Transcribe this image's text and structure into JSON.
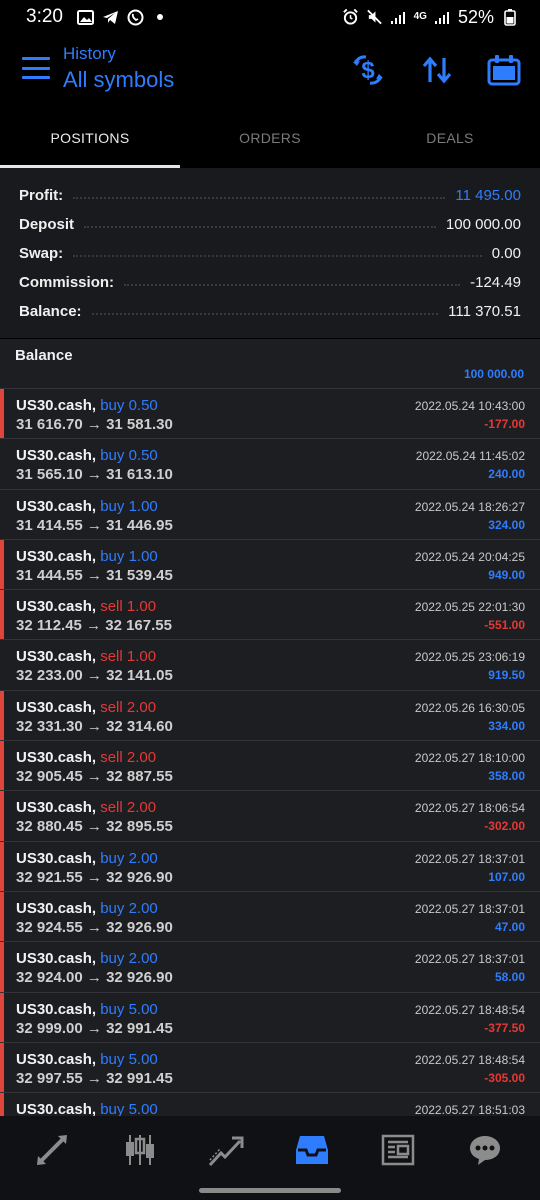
{
  "status_bar": {
    "time": "3:20",
    "battery": "52%",
    "network": "4G"
  },
  "header": {
    "subtitle": "History",
    "title": "All symbols"
  },
  "tabs": [
    {
      "label": "POSITIONS",
      "active": true
    },
    {
      "label": "ORDERS",
      "active": false
    },
    {
      "label": "DEALS",
      "active": false
    }
  ],
  "summary": [
    {
      "label": "Profit:",
      "value": "11 495.00",
      "accent": "blue"
    },
    {
      "label": "Deposit",
      "value": "100 000.00",
      "accent": ""
    },
    {
      "label": "Swap:",
      "value": "0.00",
      "accent": ""
    },
    {
      "label": "Commission:",
      "value": "-124.49",
      "accent": ""
    },
    {
      "label": "Balance:",
      "value": "111 370.51",
      "accent": ""
    }
  ],
  "balance_entry": {
    "label": "Balance",
    "value": "100 000.00"
  },
  "trades": [
    {
      "symbol": "US30.cash,",
      "side": "buy",
      "side_label": "buy 0.50",
      "prices": "31 616.70 → 31 581.30",
      "time": "2022.05.24 10:43:00",
      "pl": "-177.00",
      "pl_sign": "neg",
      "marked": true
    },
    {
      "symbol": "US30.cash,",
      "side": "buy",
      "side_label": "buy 0.50",
      "prices": "31 565.10 → 31 613.10",
      "time": "2022.05.24 11:45:02",
      "pl": "240.00",
      "pl_sign": "pos",
      "marked": false
    },
    {
      "symbol": "US30.cash,",
      "side": "buy",
      "side_label": "buy 1.00",
      "prices": "31 414.55 → 31 446.95",
      "time": "2022.05.24 18:26:27",
      "pl": "324.00",
      "pl_sign": "pos",
      "marked": false
    },
    {
      "symbol": "US30.cash,",
      "side": "buy",
      "side_label": "buy 1.00",
      "prices": "31 444.55 → 31 539.45",
      "time": "2022.05.24 20:04:25",
      "pl": "949.00",
      "pl_sign": "pos",
      "marked": true
    },
    {
      "symbol": "US30.cash,",
      "side": "sell",
      "side_label": "sell 1.00",
      "prices": "32 112.45 → 32 167.55",
      "time": "2022.05.25 22:01:30",
      "pl": "-551.00",
      "pl_sign": "neg",
      "marked": true
    },
    {
      "symbol": "US30.cash,",
      "side": "sell",
      "side_label": "sell 1.00",
      "prices": "32 233.00 → 32 141.05",
      "time": "2022.05.25 23:06:19",
      "pl": "919.50",
      "pl_sign": "pos",
      "marked": false
    },
    {
      "symbol": "US30.cash,",
      "side": "sell",
      "side_label": "sell 2.00",
      "prices": "32 331.30 → 32 314.60",
      "time": "2022.05.26 16:30:05",
      "pl": "334.00",
      "pl_sign": "pos",
      "marked": true
    },
    {
      "symbol": "US30.cash,",
      "side": "sell",
      "side_label": "sell 2.00",
      "prices": "32 905.45 → 32 887.55",
      "time": "2022.05.27 18:10:00",
      "pl": "358.00",
      "pl_sign": "pos",
      "marked": true
    },
    {
      "symbol": "US30.cash,",
      "side": "sell",
      "side_label": "sell 2.00",
      "prices": "32 880.45 → 32 895.55",
      "time": "2022.05.27 18:06:54",
      "pl": "-302.00",
      "pl_sign": "neg",
      "marked": true
    },
    {
      "symbol": "US30.cash,",
      "side": "buy",
      "side_label": "buy 2.00",
      "prices": "32 921.55 → 32 926.90",
      "time": "2022.05.27 18:37:01",
      "pl": "107.00",
      "pl_sign": "pos",
      "marked": true
    },
    {
      "symbol": "US30.cash,",
      "side": "buy",
      "side_label": "buy 2.00",
      "prices": "32 924.55 → 32 926.90",
      "time": "2022.05.27 18:37:01",
      "pl": "47.00",
      "pl_sign": "pos",
      "marked": true
    },
    {
      "symbol": "US30.cash,",
      "side": "buy",
      "side_label": "buy 2.00",
      "prices": "32 924.00 → 32 926.90",
      "time": "2022.05.27 18:37:01",
      "pl": "58.00",
      "pl_sign": "pos",
      "marked": true
    },
    {
      "symbol": "US30.cash,",
      "side": "buy",
      "side_label": "buy 5.00",
      "prices": "32 999.00 → 32 991.45",
      "time": "2022.05.27 18:48:54",
      "pl": "-377.50",
      "pl_sign": "neg",
      "marked": true
    },
    {
      "symbol": "US30.cash,",
      "side": "buy",
      "side_label": "buy 5.00",
      "prices": "32 997.55 → 32 991.45",
      "time": "2022.05.27 18:48:54",
      "pl": "-305.00",
      "pl_sign": "neg",
      "marked": true
    },
    {
      "symbol": "US30.cash,",
      "side": "buy",
      "side_label": "buy 5.00",
      "prices": "",
      "time": "2022.05.27 18:51:03",
      "pl": "",
      "pl_sign": "pos",
      "marked": true
    }
  ],
  "bottom_nav": [
    {
      "icon": "quotes-icon",
      "active": false
    },
    {
      "icon": "chart-icon",
      "active": false
    },
    {
      "icon": "trade-icon",
      "active": false
    },
    {
      "icon": "history-icon",
      "active": true
    },
    {
      "icon": "news-icon",
      "active": false
    },
    {
      "icon": "messages-icon",
      "active": false
    }
  ],
  "colors": {
    "accent": "#2f7dff",
    "negative": "#e53935",
    "marker": "#e0443a"
  }
}
